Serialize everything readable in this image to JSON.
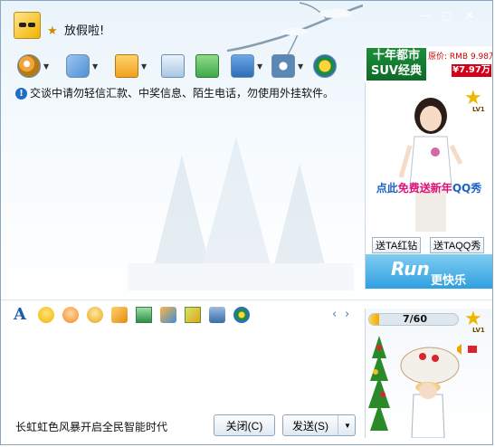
{
  "window": {
    "nickname": "放假啦!",
    "controls": [
      "—",
      "□",
      "✕"
    ]
  },
  "toolbar": {
    "items": [
      {
        "name": "video-call",
        "color": "#f2a43a"
      },
      {
        "name": "voice-call",
        "color": "#4f8fd6"
      },
      {
        "name": "send-file",
        "color": "#2f7fd0"
      },
      {
        "name": "send-message-board",
        "color": "#7aa6cf"
      },
      {
        "name": "create-group",
        "color": "#3ea84a"
      },
      {
        "name": "remote-assist",
        "color": "#2d6cb8"
      },
      {
        "name": "app-settings",
        "color": "#5c87b4"
      },
      {
        "name": "more-apps",
        "color": "#1f8c3b"
      }
    ]
  },
  "notice": {
    "text": "交谈中请勿轻信汇款、中奖信息、陌生电话，勿使用外挂软件。"
  },
  "ad": {
    "car_title_line1": "十年都市",
    "car_title_line2": "SUV经典",
    "car_price_label": "原价: RMB 9.98万",
    "car_price_sale": "¥7.97万",
    "level_badge": "LV1",
    "promo_prefix": "点此",
    "promo_highlight": "免费送新年",
    "promo_suffix": "QQ秀",
    "send_red_diamond": "送TA红钻",
    "send_qq_show": "送TAQQ秀",
    "footer_text1": "Run",
    "footer_text2": "更快乐"
  },
  "format_bar": {
    "items": [
      "font",
      "emoticon",
      "magic-emoticon",
      "shake",
      "doodle",
      "screenshot",
      "music",
      "gift",
      "image",
      "more"
    ],
    "font_label": "A",
    "prev_label": "‹",
    "next_label": "›"
  },
  "show_panel": {
    "progress_text": "7/60",
    "progress_value": 0.117,
    "level_badge": "LV1"
  },
  "footer": {
    "slogan": "长虹虹色风暴开启全民智能时代",
    "close_label": "关闭(C)",
    "send_label": "发送(S)"
  },
  "colors": {
    "accent": "#1e6fc4",
    "ad_pink": "#e2127a",
    "sale_red": "#d4001b",
    "border": "#8aa6c3"
  }
}
